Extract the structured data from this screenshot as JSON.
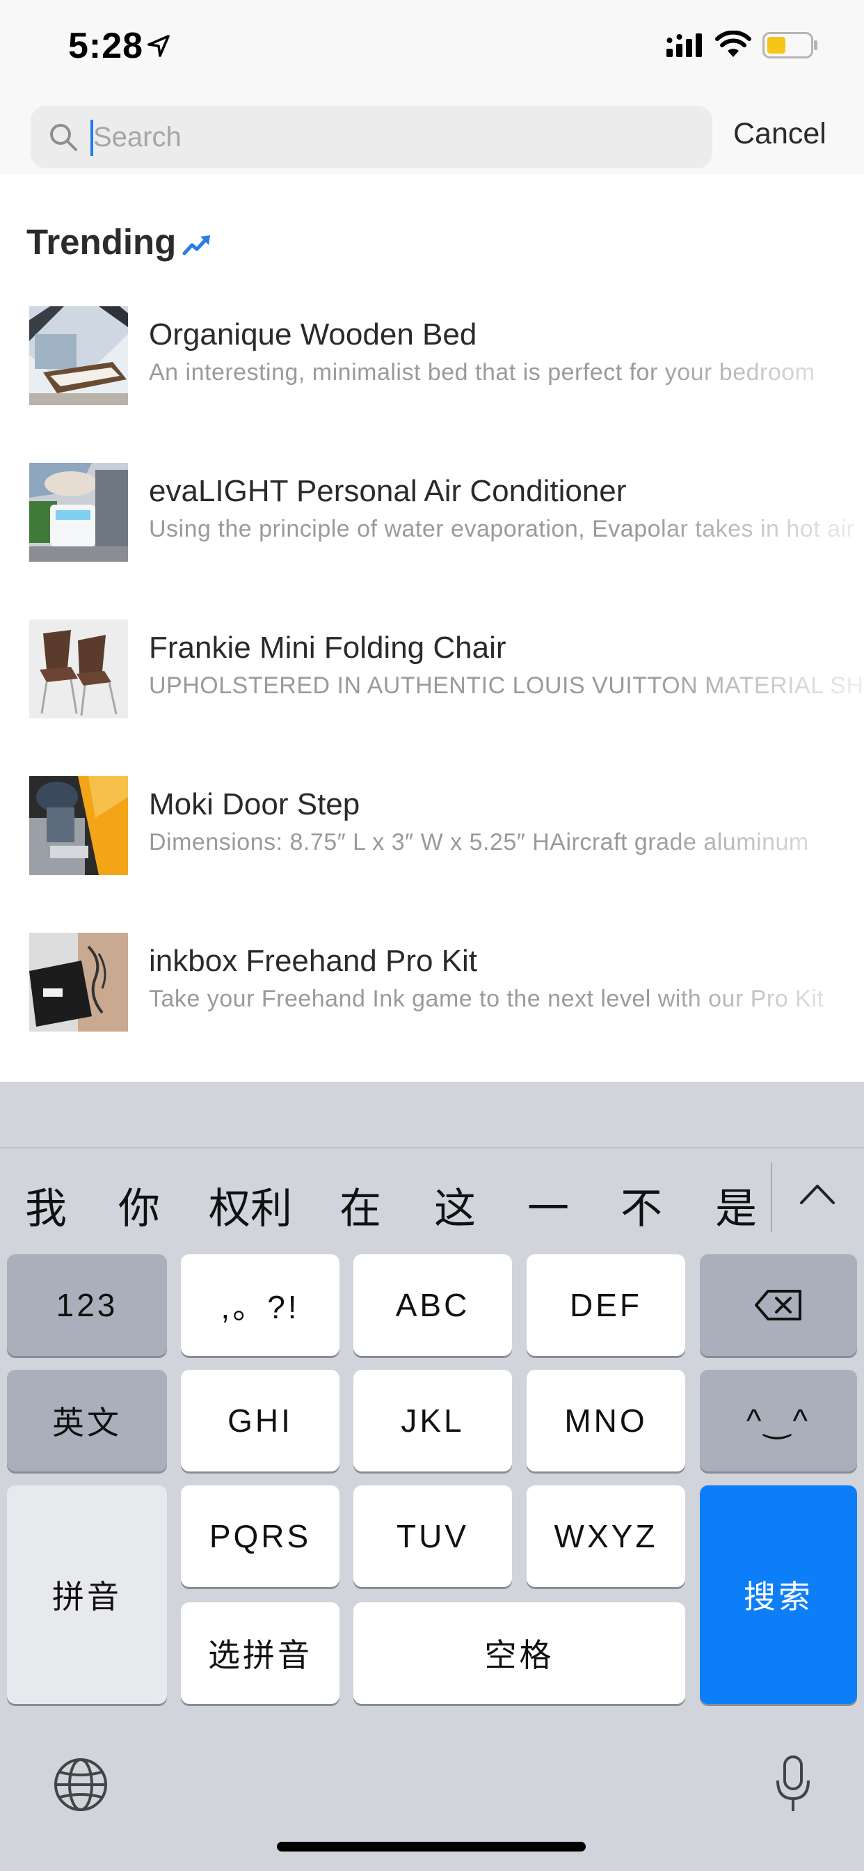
{
  "status": {
    "time": "5:28",
    "icons": [
      "location-arrow-icon",
      "signal-icon",
      "wifi-icon",
      "battery-icon"
    ],
    "battery_color": "#f5c518"
  },
  "search": {
    "placeholder": "Search",
    "value": "",
    "cancel_label": "Cancel"
  },
  "trending": {
    "title": "Trending",
    "items": [
      {
        "title": "Organique Wooden Bed",
        "description": "An interesting, minimalist bed that is perfect for your bedroom"
      },
      {
        "title": "evaLIGHT Personal Air Conditioner",
        "description": "Using the principle of water evaporation, Evapolar takes in hot air"
      },
      {
        "title": "Frankie Mini Folding Chair",
        "description": "UPHOLSTERED IN AUTHENTIC LOUIS VUITTON MATERIAL SHIPS"
      },
      {
        "title": "Moki Door Step",
        "description": "Dimensions: 8.75″ L x 3″ W x 5.25″ HAircraft grade aluminum"
      },
      {
        "title": "inkbox Freehand Pro Kit",
        "description": "Take your Freehand Ink game to the next level with our Pro Kit"
      }
    ]
  },
  "keyboard": {
    "candidates": [
      "我",
      "你",
      "权利",
      "在",
      "这",
      "一",
      "不",
      "是"
    ],
    "keys": {
      "numbers": "123",
      "punct": ",。?!",
      "abc": "ABC",
      "def": "DEF",
      "english": "英文",
      "ghi": "GHI",
      "jkl": "JKL",
      "mno": "MNO",
      "emoji": "^‿^",
      "pinyin": "拼音",
      "pqrs": "PQRS",
      "tuv": "TUV",
      "wxyz": "WXYZ",
      "search": "搜索",
      "select_pinyin": "选拼音",
      "space": "空格"
    },
    "accent_color": "#0c7ef8"
  }
}
